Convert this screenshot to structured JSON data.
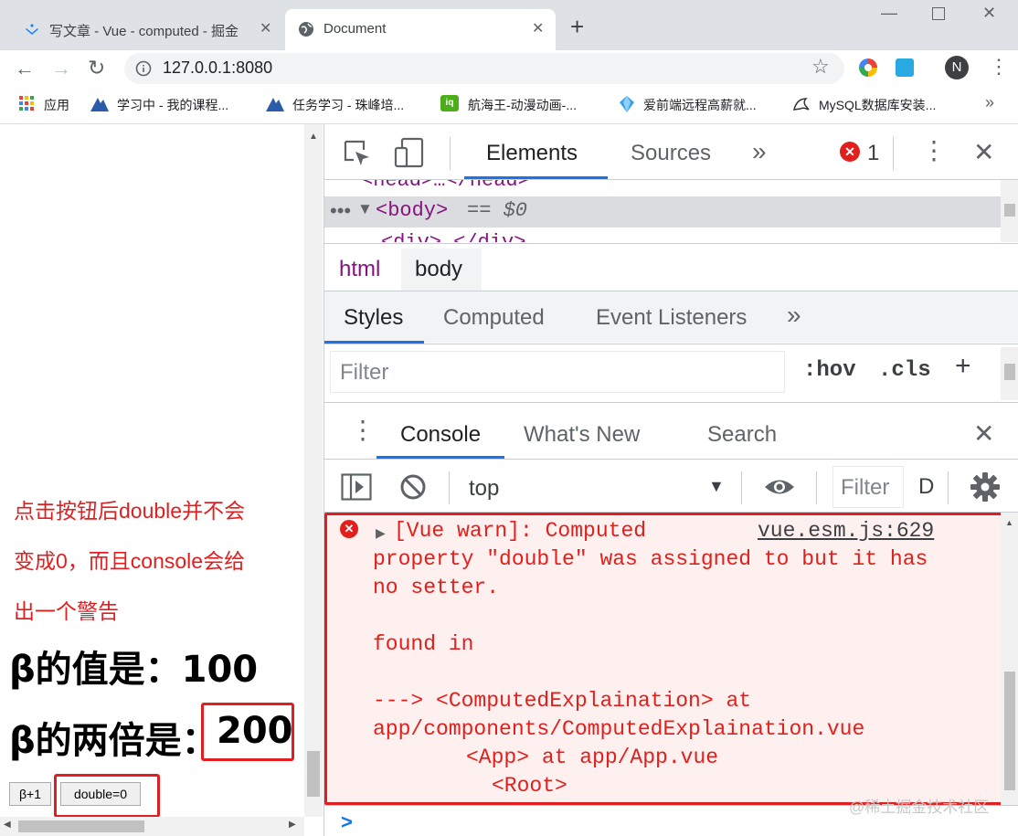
{
  "browser": {
    "tabs": [
      {
        "title": "写文章 - Vue - computed - 掘金",
        "active": false
      },
      {
        "title": "Document",
        "active": true
      }
    ],
    "new_tab_label": "+",
    "url": "127.0.0.1:8080",
    "profile_initial": "N",
    "bookmarks": [
      {
        "label": "应用"
      },
      {
        "label": "学习中 - 我的课程..."
      },
      {
        "label": "任务学习 - 珠峰培..."
      },
      {
        "label": "航海王-动漫动画-..."
      },
      {
        "label": "爱前端远程高薪就..."
      },
      {
        "label": "MySQL数据库安装..."
      }
    ],
    "bookmarks_more": "»"
  },
  "page": {
    "annotation_lines": [
      "点击按钮后double并不会",
      "变成0，而且console会给",
      "出一个警告"
    ],
    "beta_value_label": "β的值是：",
    "beta_value": "100",
    "double_label": "β的两倍是：",
    "double_value": "200",
    "btn_increment": "β+1",
    "btn_set_double": "double=0"
  },
  "devtools": {
    "main_tabs": [
      "Elements",
      "Sources"
    ],
    "more_tabs": "»",
    "error_count": "1",
    "dom": {
      "head_line": "<head>…</head>",
      "body_line": "<body>",
      "body_suffix": "== $0",
      "next_line": "<div>…</div>"
    },
    "breadcrumbs": [
      "html",
      "body"
    ],
    "styles_tabs": [
      "Styles",
      "Computed",
      "Event Listeners"
    ],
    "filter_placeholder": "Filter",
    "hov": ":hov",
    "cls": ".cls",
    "drawer_tabs": [
      "Console",
      "What's New",
      "Search"
    ],
    "context": "top",
    "console_filter_placeholder": "Filter",
    "console_filter_extra": "D",
    "console": {
      "message_line1": "[Vue warn]: Computed",
      "source_link": "vue.esm.js:629",
      "message_line2": "property \"double\" was assigned to but it has",
      "message_line3": "no setter.",
      "found_in": "found in",
      "trace1": "---> <ComputedExplaination> at",
      "trace2": "app/components/ComputedExplaination.vue",
      "trace3": "<App> at app/App.vue",
      "trace4": "<Root>",
      "prompt": ">"
    }
  },
  "watermark": "@稀土掘金技术社区",
  "colors": {
    "highlight_red": "#e02020",
    "accent_blue": "#1a73e8",
    "error_bg": "#fff0f0",
    "error_text": "#e0201c"
  }
}
